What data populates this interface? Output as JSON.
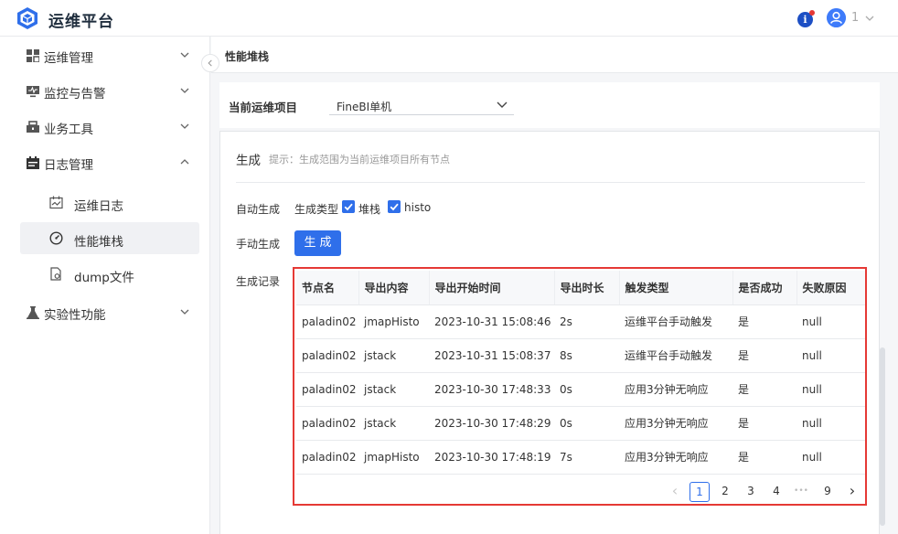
{
  "app": {
    "title": "运维平台",
    "user_number": "1"
  },
  "sidebar": {
    "items": [
      {
        "label": "运维管理",
        "icon": "grid-icon"
      },
      {
        "label": "监控与告警",
        "icon": "monitor-icon"
      },
      {
        "label": "业务工具",
        "icon": "tools-icon"
      },
      {
        "label": "日志管理",
        "icon": "calendar-icon"
      },
      {
        "label": "实验性功能",
        "icon": "flask-icon"
      }
    ],
    "sub_items": [
      {
        "label": "运维日志",
        "icon": "log-calendar-icon"
      },
      {
        "label": "性能堆栈",
        "icon": "gauge-icon",
        "active": true
      },
      {
        "label": "dump文件",
        "icon": "file-settings-icon"
      }
    ]
  },
  "page": {
    "title": "性能堆栈"
  },
  "project": {
    "label": "当前运维项目",
    "value": "FineBI单机"
  },
  "generate": {
    "title": "生成",
    "hint": "提示：生成范围为当前运维项目所有节点",
    "auto_label": "自动生成",
    "type_label": "生成类型",
    "type_options": [
      {
        "label": "堆栈",
        "checked": true
      },
      {
        "label": "histo",
        "checked": true
      }
    ],
    "manual_label": "手动生成",
    "button_label": "生成",
    "records_label": "生成记录"
  },
  "table": {
    "columns": [
      "节点名",
      "导出内容",
      "导出开始时间",
      "导出时长",
      "触发类型",
      "是否成功",
      "失败原因"
    ],
    "rows": [
      [
        "paladin02",
        "jmapHisto",
        "2023-10-31 15:08:46",
        "2s",
        "运维平台手动触发",
        "是",
        "null"
      ],
      [
        "paladin02",
        "jstack",
        "2023-10-31 15:08:37",
        "8s",
        "运维平台手动触发",
        "是",
        "null"
      ],
      [
        "paladin02",
        "jstack",
        "2023-10-30 17:48:33",
        "0s",
        "应用3分钟无响应",
        "是",
        "null"
      ],
      [
        "paladin02",
        "jstack",
        "2023-10-30 17:48:29",
        "0s",
        "应用3分钟无响应",
        "是",
        "null"
      ],
      [
        "paladin02",
        "jmapHisto",
        "2023-10-30 17:48:19",
        "7s",
        "应用3分钟无响应",
        "是",
        "null"
      ]
    ]
  },
  "pagination": {
    "prev": "‹",
    "pages": [
      "1",
      "2",
      "3",
      "4"
    ],
    "ellipsis": "•••",
    "last": "9",
    "next": "›",
    "current": "1"
  },
  "colors": {
    "accent": "#2f6fea",
    "highlight_border": "#e53935",
    "notification": "#e53935"
  }
}
